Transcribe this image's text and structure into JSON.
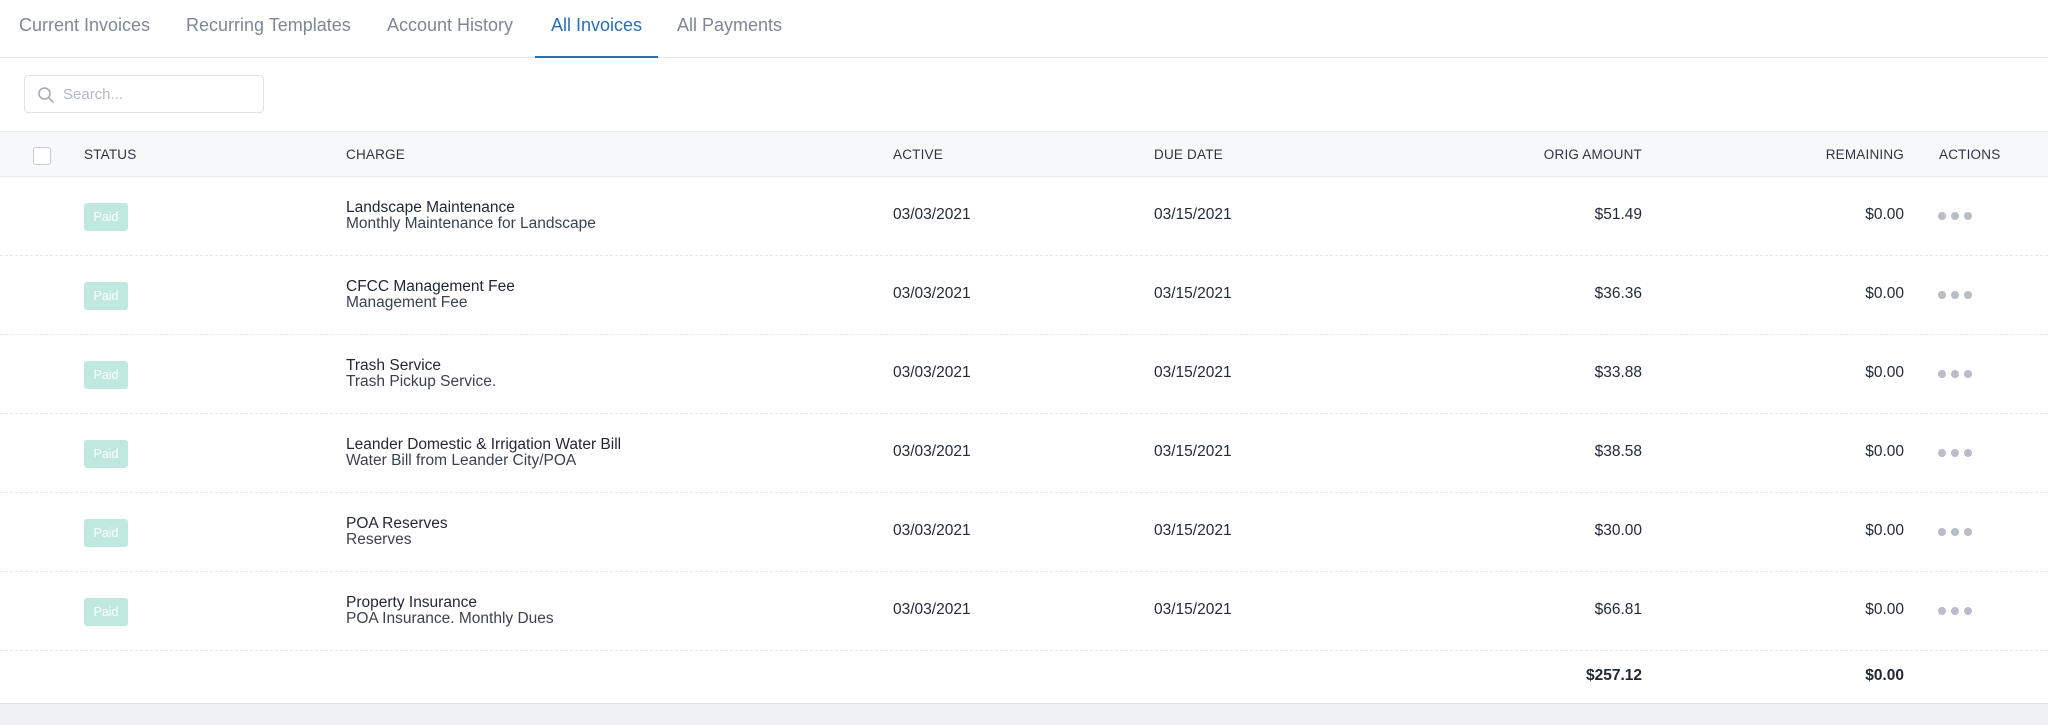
{
  "tabs": [
    {
      "label": "Current Invoices",
      "active": false
    },
    {
      "label": "Recurring Templates",
      "active": false
    },
    {
      "label": "Account History",
      "active": false
    },
    {
      "label": "All Invoices",
      "active": true
    },
    {
      "label": "All Payments",
      "active": false
    }
  ],
  "search": {
    "placeholder": "Search...",
    "value": "",
    "icon": "search-icon"
  },
  "table": {
    "headers": {
      "status": "STATUS",
      "charge": "CHARGE",
      "active": "ACTIVE",
      "due_date": "DUE DATE",
      "orig_amount": "ORIG AMOUNT",
      "remaining": "REMAINING",
      "actions": "ACTIONS"
    },
    "rows": [
      {
        "status": "Paid",
        "charge_title": "Landscape Maintenance",
        "charge_desc": "Monthly Maintenance for Landscape",
        "active": "03/03/2021",
        "due_date": "03/15/2021",
        "orig_amount": "$51.49",
        "remaining": "$0.00"
      },
      {
        "status": "Paid",
        "charge_title": "CFCC Management Fee",
        "charge_desc": "Management Fee",
        "active": "03/03/2021",
        "due_date": "03/15/2021",
        "orig_amount": "$36.36",
        "remaining": "$0.00"
      },
      {
        "status": "Paid",
        "charge_title": "Trash Service",
        "charge_desc": "Trash Pickup Service.",
        "active": "03/03/2021",
        "due_date": "03/15/2021",
        "orig_amount": "$33.88",
        "remaining": "$0.00"
      },
      {
        "status": "Paid",
        "charge_title": "Leander Domestic & Irrigation Water Bill",
        "charge_desc": "Water Bill from Leander City/POA",
        "active": "03/03/2021",
        "due_date": "03/15/2021",
        "orig_amount": "$38.58",
        "remaining": "$0.00"
      },
      {
        "status": "Paid",
        "charge_title": "POA Reserves",
        "charge_desc": "Reserves",
        "active": "03/03/2021",
        "due_date": "03/15/2021",
        "orig_amount": "$30.00",
        "remaining": "$0.00"
      },
      {
        "status": "Paid",
        "charge_title": "Property Insurance",
        "charge_desc": "POA Insurance. Monthly Dues",
        "active": "03/03/2021",
        "due_date": "03/15/2021",
        "orig_amount": "$66.81",
        "remaining": "$0.00"
      }
    ],
    "totals": {
      "orig_amount": "$257.12",
      "remaining": "$0.00"
    }
  },
  "colors": {
    "accent": "#2a6fb6",
    "paid_badge": "#bfe8df",
    "header_bg": "#f7f8fa"
  }
}
